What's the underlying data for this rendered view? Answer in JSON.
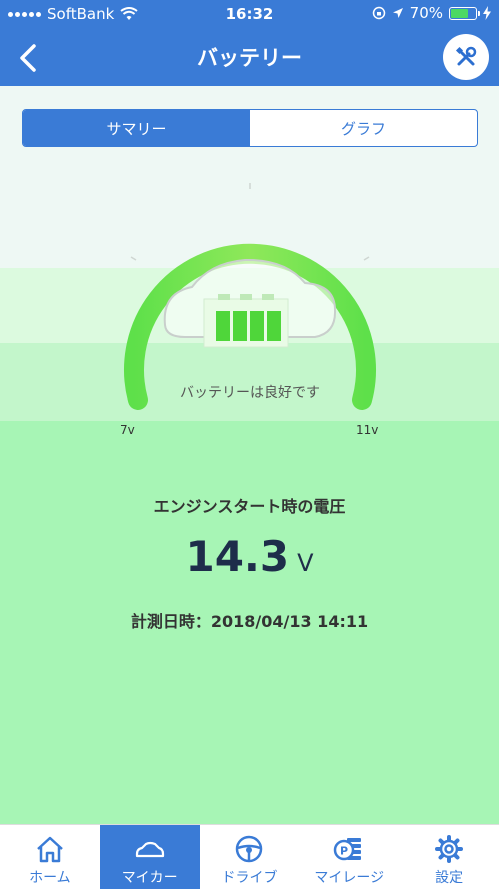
{
  "status_bar": {
    "carrier": "SoftBank",
    "time": "16:32",
    "battery_percent": "70%",
    "battery_level": 0.7
  },
  "nav": {
    "title": "バッテリー"
  },
  "segments": {
    "summary": "サマリー",
    "graph": "グラフ",
    "selected": "summary"
  },
  "gauge": {
    "status_text": "バッテリーは良好です",
    "min_label": "7v",
    "max_label": "11v"
  },
  "voltage": {
    "title": "エンジンスタート時の電圧",
    "value": "14.3",
    "unit": "V",
    "measured_at": "計測日時：2018/04/13 14:11"
  },
  "tabs": [
    {
      "label": "ホーム",
      "icon": "home-icon",
      "active": false
    },
    {
      "label": "マイカー",
      "icon": "car-icon",
      "active": true
    },
    {
      "label": "ドライブ",
      "icon": "steering-wheel-icon",
      "active": false
    },
    {
      "label": "マイレージ",
      "icon": "coins-icon",
      "active": false
    },
    {
      "label": "設定",
      "icon": "gear-icon",
      "active": false
    }
  ],
  "colors": {
    "primary": "#3a7bd6",
    "gauge_green": "#6fdc4a",
    "background_green": "#a7f5b5"
  }
}
